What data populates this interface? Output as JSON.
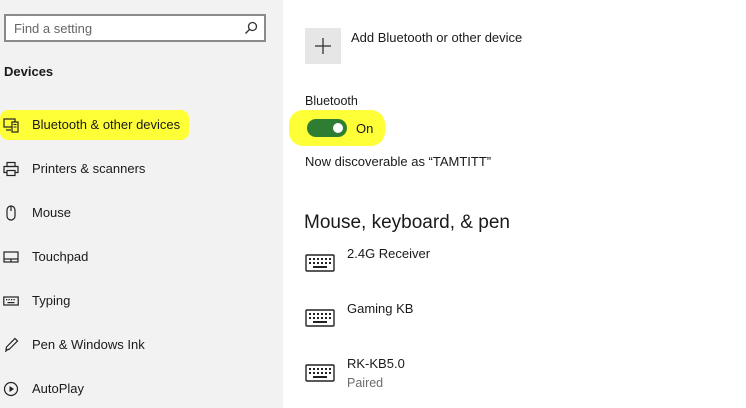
{
  "search": {
    "placeholder": "Find a setting",
    "icon": "search-icon"
  },
  "sidebar": {
    "section_heading": "Devices",
    "highlight_color": "#ffff38",
    "items": [
      {
        "label": "Bluetooth & other devices",
        "icon": "bluetooth-devices-icon",
        "selected": true
      },
      {
        "label": "Printers & scanners",
        "icon": "printer-icon",
        "selected": false
      },
      {
        "label": "Mouse",
        "icon": "mouse-icon",
        "selected": false
      },
      {
        "label": "Touchpad",
        "icon": "touchpad-icon",
        "selected": false
      },
      {
        "label": "Typing",
        "icon": "keyboard-icon",
        "selected": false
      },
      {
        "label": "Pen & Windows Ink",
        "icon": "pen-icon",
        "selected": false
      },
      {
        "label": "AutoPlay",
        "icon": "autoplay-icon",
        "selected": false
      }
    ]
  },
  "main": {
    "add_device_label": "Add Bluetooth or other device",
    "bluetooth_heading": "Bluetooth",
    "bluetooth_toggle": {
      "state_label": "On",
      "on": true,
      "color": "#2f7d32"
    },
    "discoverable_text": "Now discoverable as “TAMTITT”",
    "section_title": "Mouse, keyboard, & pen",
    "devices": [
      {
        "name": "2.4G Receiver",
        "status": "",
        "icon": "keyboard-icon"
      },
      {
        "name": "Gaming KB",
        "status": "",
        "icon": "keyboard-icon"
      },
      {
        "name": "RK-KB5.0",
        "status": "Paired",
        "icon": "keyboard-icon"
      }
    ]
  }
}
